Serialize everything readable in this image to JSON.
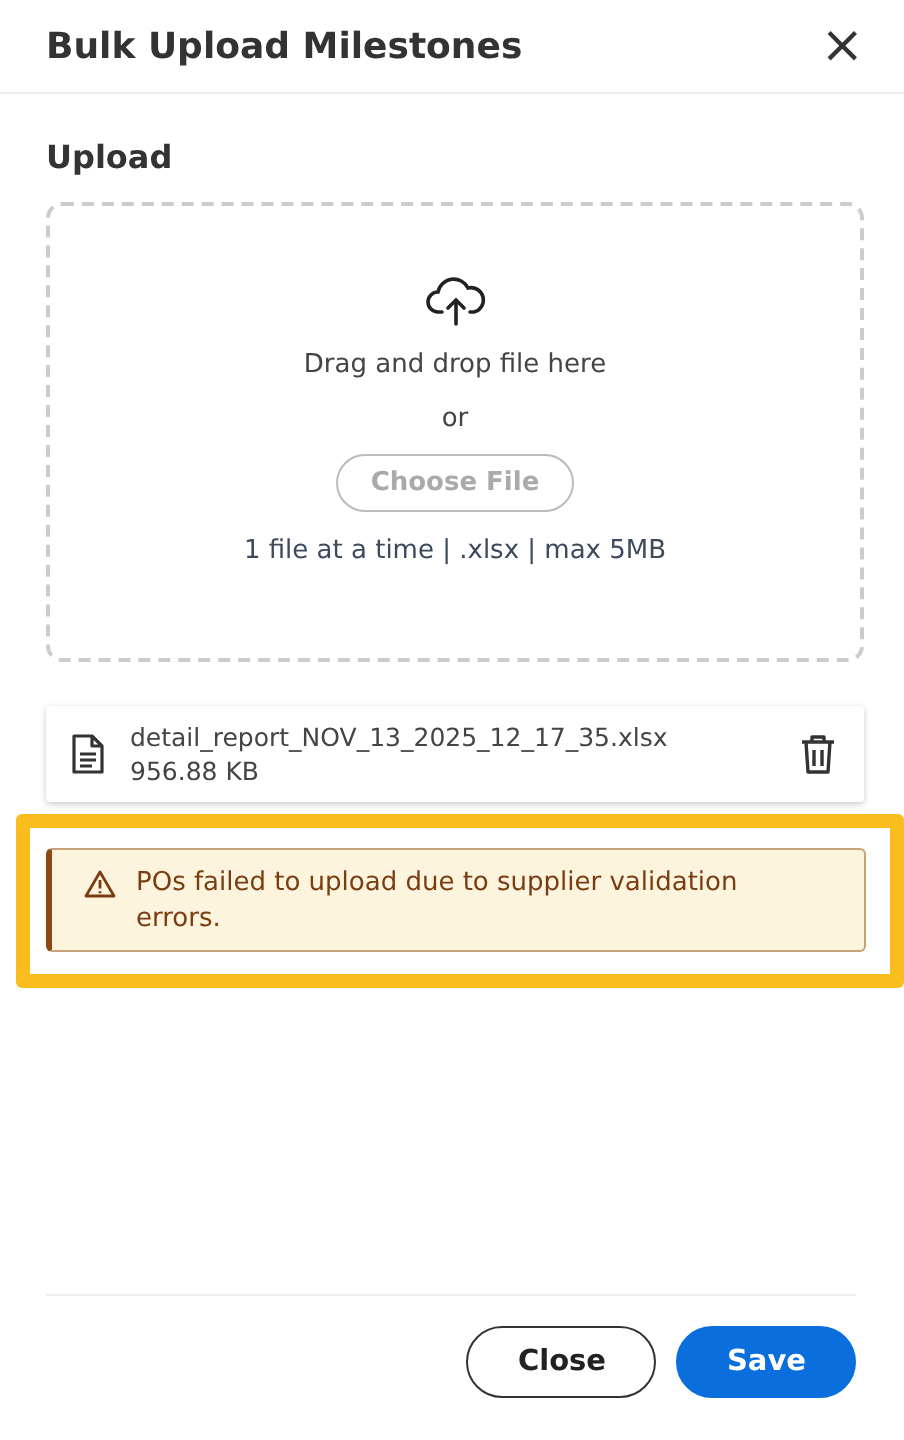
{
  "dialog": {
    "title": "Bulk Upload Milestones",
    "close_icon": "×"
  },
  "upload": {
    "heading": "Upload",
    "prompt": "Drag and drop file here",
    "separator": "or",
    "choose_button": {
      "label": "Choose File",
      "disabled": true
    },
    "hint": "1 file at a time | .xlsx | max 5MB"
  },
  "files": [
    {
      "name": "detail_report_NOV_13_2025_12_17_35.xlsx",
      "size": "956.88 KB"
    }
  ],
  "alert": {
    "kind": "warning",
    "message": "POs failed to upload due to supplier validation errors.",
    "highlighted": true
  },
  "buttons": [
    {
      "label": "Close",
      "kind": "secondary"
    },
    {
      "label": "Save",
      "kind": "primary"
    }
  ]
}
